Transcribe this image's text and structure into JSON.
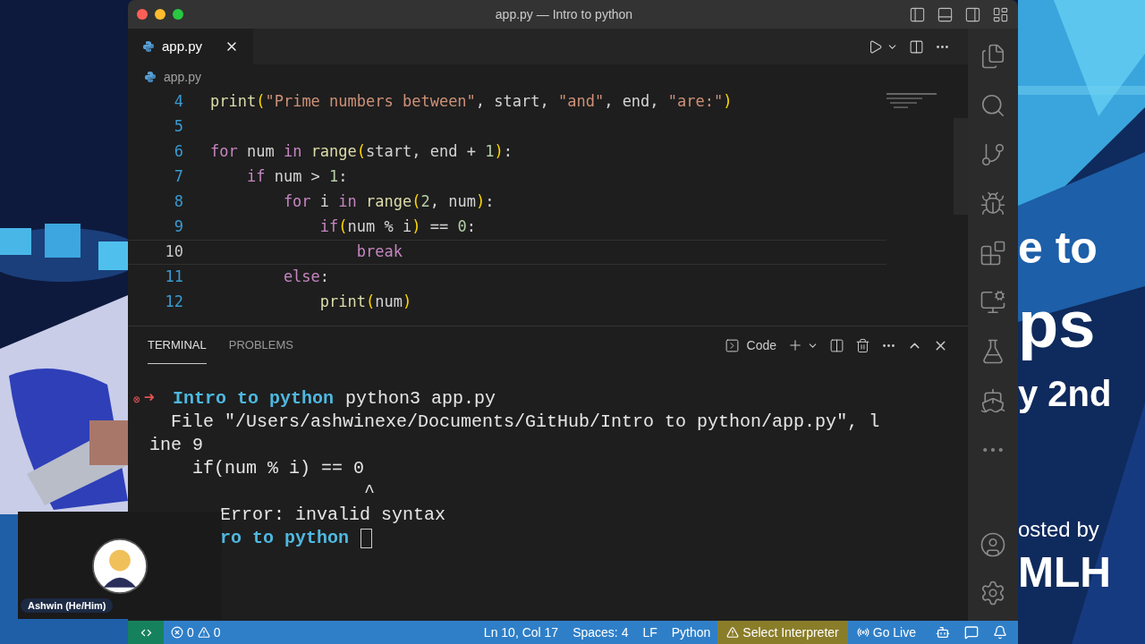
{
  "window": {
    "title": "app.py — Intro to python"
  },
  "tabs": [
    {
      "label": "app.py",
      "selected": true
    }
  ],
  "breadcrumb": [
    "app.py"
  ],
  "editor": {
    "lines": [
      {
        "number": "4",
        "current": false,
        "tokens": [
          {
            "kind": "fn",
            "text": "print"
          },
          {
            "kind": "paren",
            "text": "("
          },
          {
            "kind": "str",
            "text": "\"Prime numbers between\""
          },
          {
            "kind": "plain",
            "text": ", start, "
          },
          {
            "kind": "str",
            "text": "\"and\""
          },
          {
            "kind": "plain",
            "text": ", end, "
          },
          {
            "kind": "str",
            "text": "\"are:\""
          },
          {
            "kind": "paren",
            "text": ")"
          }
        ]
      },
      {
        "number": "5",
        "current": false
      },
      {
        "number": "6",
        "current": false,
        "tokens": [
          {
            "kind": "kw",
            "text": "for"
          },
          {
            "kind": "plain",
            "text": " num "
          },
          {
            "kind": "kw",
            "text": "in"
          },
          {
            "kind": "fn",
            "text": " range"
          },
          {
            "kind": "paren",
            "text": "("
          },
          {
            "kind": "plain",
            "text": "start, end + "
          },
          {
            "kind": "num",
            "text": "1"
          },
          {
            "kind": "paren",
            "text": ")"
          },
          {
            "kind": "plain",
            "text": ":"
          }
        ]
      },
      {
        "number": "7",
        "current": false,
        "tokens": [
          {
            "kind": "kw",
            "text": "    if"
          },
          {
            "kind": "plain",
            "text": " num > "
          },
          {
            "kind": "num",
            "text": "1"
          },
          {
            "kind": "plain",
            "text": ":"
          }
        ]
      },
      {
        "number": "8",
        "current": false,
        "tokens": [
          {
            "kind": "kw",
            "text": "        for"
          },
          {
            "kind": "plain",
            "text": " i "
          },
          {
            "kind": "kw",
            "text": "in"
          },
          {
            "kind": "fn",
            "text": " range"
          },
          {
            "kind": "paren",
            "text": "("
          },
          {
            "kind": "num",
            "text": "2"
          },
          {
            "kind": "plain",
            "text": ", num"
          },
          {
            "kind": "paren",
            "text": ")"
          },
          {
            "kind": "plain",
            "text": ":"
          }
        ]
      },
      {
        "number": "9",
        "current": false,
        "tokens": [
          {
            "kind": "kw",
            "text": "            if"
          },
          {
            "kind": "paren",
            "text": "("
          },
          {
            "kind": "plain",
            "text": "num % i"
          },
          {
            "kind": "paren",
            "text": ")"
          },
          {
            "kind": "plain",
            "text": " == "
          },
          {
            "kind": "num",
            "text": "0"
          },
          {
            "kind": "plain",
            "text": ":"
          }
        ]
      },
      {
        "number": "10",
        "current": true,
        "tokens": [
          {
            "kind": "kw",
            "text": "                break"
          }
        ]
      },
      {
        "number": "11",
        "current": false,
        "tokens": [
          {
            "kind": "kw",
            "text": "        else"
          },
          {
            "kind": "plain",
            "text": ":"
          }
        ]
      },
      {
        "number": "12",
        "current": false,
        "tokens": [
          {
            "kind": "fn",
            "text": "            print"
          },
          {
            "kind": "paren",
            "text": "("
          },
          {
            "kind": "plain",
            "text": "num"
          },
          {
            "kind": "paren",
            "text": ")"
          }
        ]
      }
    ]
  },
  "panel": {
    "tabs": [
      {
        "label": "TERMINAL",
        "selected": true
      },
      {
        "label": "PROBLEMS",
        "selected": false
      }
    ],
    "terminal_name": "Code",
    "lines": [
      {
        "kind": "prompt",
        "failed": true,
        "status_icon": "⊗",
        "arrow": "➜",
        "dir": "Intro to python",
        "command": "python3 app.py"
      },
      {
        "kind": "output",
        "text": "  File \"/Users/ashwinexe/Documents/GitHub/Intro to python/app.py\", l"
      },
      {
        "kind": "output",
        "text": "ine 9"
      },
      {
        "kind": "output",
        "text": "    if(num % i) == 0"
      },
      {
        "kind": "output",
        "text": "                    ^"
      },
      {
        "kind": "covered-output",
        "text": "Error: invalid syntax"
      },
      {
        "kind": "covered-prompt",
        "dir": "ro to python",
        "cursor": true
      }
    ]
  },
  "status_bar": {
    "errors": "0",
    "warnings": "0",
    "position": "Ln 10, Col 17",
    "spaces": "Spaces: 4",
    "eol": "LF",
    "language": "Python",
    "interpreter": "Select Interpreter",
    "live": "Go Live"
  },
  "slide": {
    "texts": [
      "e to",
      "ps",
      "y 2nd",
      "osted by",
      "MLH"
    ]
  },
  "call_tile": {
    "name": "Ashwin (He/Him)"
  }
}
